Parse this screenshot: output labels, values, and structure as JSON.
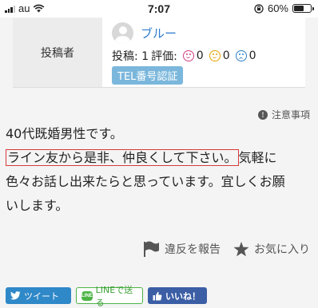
{
  "status_bar": {
    "carrier": "au",
    "time": "7:07",
    "battery": "60%",
    "battery_level": 0.6
  },
  "poster": {
    "label": "投稿者",
    "name": "ブルー",
    "posts_label": "投稿: 1",
    "rating_label": "評価:",
    "good_count": "0",
    "neutral_count": "0",
    "bad_count": "0",
    "tel_badge": "TEL番号認証"
  },
  "notice": {
    "label": "注意事項"
  },
  "message": {
    "line1": "40代既婚男性です。",
    "highlight": "ライン友から是非、仲良くして下さい。",
    "after_highlight": "気軽に",
    "line3": "色々お話し出来たらと思っています。宜しくお願",
    "line4": "いします。"
  },
  "actions": {
    "report": "違反を報告",
    "favorite": "お気に入り"
  },
  "share": {
    "tweet": "ツイート",
    "line": "LINEで送る",
    "like": "いいね！"
  },
  "colors": {
    "link": "#2c7bd1",
    "badge": "#7bb7dc",
    "highlight_border": "#d63b3b",
    "twitter": "#2f88c8",
    "line": "#4bb445",
    "facebook": "#3b5ea5"
  }
}
